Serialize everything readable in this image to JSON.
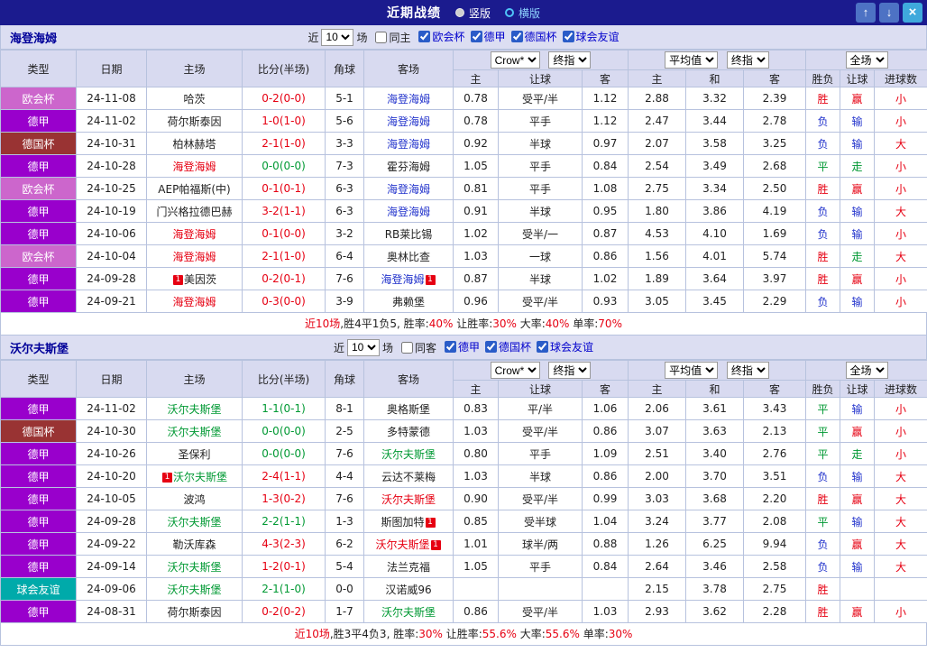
{
  "title_bar": {
    "title": "近期战绩",
    "vertical_label": "竖版",
    "horizontal_label": "横版",
    "up_icon": "↑",
    "down_icon": "↓",
    "close_icon": "×"
  },
  "colors": {
    "red": "#e60012",
    "green": "#009933",
    "blue": "#2233cc",
    "black": "#222222"
  },
  "league_colors": {
    "欧会杯": "#cc66cc",
    "德甲": "#9900cc",
    "德国杯": "#993333",
    "球会友谊": "#00aaaa"
  },
  "table_header": {
    "base_cols": [
      "类型",
      "日期",
      "主场",
      "比分(半场)",
      "角球",
      "客场"
    ],
    "sub_cols": [
      "主",
      "让球",
      "客",
      "主",
      "和",
      "客",
      "胜负",
      "让球",
      "进球数"
    ],
    "selects": {
      "book": "Crow*",
      "book_time": "终指",
      "avg": "平均值",
      "avg_time": "终指",
      "full": "全场"
    }
  },
  "sections": [
    {
      "team": "海登海姆",
      "filter": {
        "near": "近",
        "count": "10",
        "games": "场",
        "same": "同主",
        "leagues": [
          "欧会杯",
          "德甲",
          "德国杯",
          "球会友谊"
        ]
      },
      "rows": [
        {
          "type": "欧会杯",
          "date": "24-11-08",
          "home": "哈茨",
          "home_color": "black",
          "home_badge": "",
          "score": "0-2(0-0)",
          "score_color": "red",
          "corners": "5-1",
          "away": "海登海姆",
          "away_color": "blue",
          "away_badge": "",
          "h_home": "0.78",
          "h_line": "受平/半",
          "h_away": "1.12",
          "e_home": "2.88",
          "e_draw": "3.32",
          "e_away": "2.39",
          "result": "胜",
          "result_color": "red",
          "h_result": "赢",
          "h_result_color": "red",
          "g_result": "小",
          "g_result_color": "red"
        },
        {
          "type": "德甲",
          "date": "24-11-02",
          "home": "荷尔斯泰因",
          "home_color": "black",
          "home_badge": "",
          "score": "1-0(1-0)",
          "score_color": "red",
          "corners": "5-6",
          "away": "海登海姆",
          "away_color": "blue",
          "away_badge": "",
          "h_home": "0.78",
          "h_line": "平手",
          "h_away": "1.12",
          "e_home": "2.47",
          "e_draw": "3.44",
          "e_away": "2.78",
          "result": "负",
          "result_color": "blue",
          "h_result": "输",
          "h_result_color": "blue",
          "g_result": "小",
          "g_result_color": "red"
        },
        {
          "type": "德国杯",
          "date": "24-10-31",
          "home": "柏林赫塔",
          "home_color": "black",
          "home_badge": "",
          "score": "2-1(1-0)",
          "score_color": "red",
          "corners": "3-3",
          "away": "海登海姆",
          "away_color": "blue",
          "away_badge": "",
          "h_home": "0.92",
          "h_line": "半球",
          "h_away": "0.97",
          "e_home": "2.07",
          "e_draw": "3.58",
          "e_away": "3.25",
          "result": "负",
          "result_color": "blue",
          "h_result": "输",
          "h_result_color": "blue",
          "g_result": "大",
          "g_result_color": "red"
        },
        {
          "type": "德甲",
          "date": "24-10-28",
          "home": "海登海姆",
          "home_color": "red",
          "home_badge": "",
          "score": "0-0(0-0)",
          "score_color": "green",
          "corners": "7-3",
          "away": "霍芬海姆",
          "away_color": "black",
          "away_badge": "",
          "h_home": "1.05",
          "h_line": "平手",
          "h_away": "0.84",
          "e_home": "2.54",
          "e_draw": "3.49",
          "e_away": "2.68",
          "result": "平",
          "result_color": "green",
          "h_result": "走",
          "h_result_color": "green",
          "g_result": "小",
          "g_result_color": "red"
        },
        {
          "type": "欧会杯",
          "date": "24-10-25",
          "home": "AEP帕福斯(中)",
          "home_color": "black",
          "home_badge": "",
          "score": "0-1(0-1)",
          "score_color": "red",
          "corners": "6-3",
          "away": "海登海姆",
          "away_color": "blue",
          "away_badge": "",
          "h_home": "0.81",
          "h_line": "平手",
          "h_away": "1.08",
          "e_home": "2.75",
          "e_draw": "3.34",
          "e_away": "2.50",
          "result": "胜",
          "result_color": "red",
          "h_result": "赢",
          "h_result_color": "red",
          "g_result": "小",
          "g_result_color": "red"
        },
        {
          "type": "德甲",
          "date": "24-10-19",
          "home": "门兴格拉德巴赫",
          "home_color": "black",
          "home_badge": "",
          "score": "3-2(1-1)",
          "score_color": "red",
          "corners": "6-3",
          "away": "海登海姆",
          "away_color": "blue",
          "away_badge": "",
          "h_home": "0.91",
          "h_line": "半球",
          "h_away": "0.95",
          "e_home": "1.80",
          "e_draw": "3.86",
          "e_away": "4.19",
          "result": "负",
          "result_color": "blue",
          "h_result": "输",
          "h_result_color": "blue",
          "g_result": "大",
          "g_result_color": "red"
        },
        {
          "type": "德甲",
          "date": "24-10-06",
          "home": "海登海姆",
          "home_color": "red",
          "home_badge": "",
          "score": "0-1(0-0)",
          "score_color": "red",
          "corners": "3-2",
          "away": "RB莱比锡",
          "away_color": "black",
          "away_badge": "",
          "h_home": "1.02",
          "h_line": "受半/一",
          "h_away": "0.87",
          "e_home": "4.53",
          "e_draw": "4.10",
          "e_away": "1.69",
          "result": "负",
          "result_color": "blue",
          "h_result": "输",
          "h_result_color": "blue",
          "g_result": "小",
          "g_result_color": "red"
        },
        {
          "type": "欧会杯",
          "date": "24-10-04",
          "home": "海登海姆",
          "home_color": "red",
          "home_badge": "",
          "score": "2-1(1-0)",
          "score_color": "red",
          "corners": "6-4",
          "away": "奥林比查",
          "away_color": "black",
          "away_badge": "",
          "h_home": "1.03",
          "h_line": "一球",
          "h_away": "0.86",
          "e_home": "1.56",
          "e_draw": "4.01",
          "e_away": "5.74",
          "result": "胜",
          "result_color": "red",
          "h_result": "走",
          "h_result_color": "green",
          "g_result": "大",
          "g_result_color": "red"
        },
        {
          "type": "德甲",
          "date": "24-09-28",
          "home": "美因茨",
          "home_color": "black",
          "home_badge": "1",
          "score": "0-2(0-1)",
          "score_color": "red",
          "corners": "7-6",
          "away": "海登海姆",
          "away_color": "blue",
          "away_badge": "1",
          "h_home": "0.87",
          "h_line": "半球",
          "h_away": "1.02",
          "e_home": "1.89",
          "e_draw": "3.64",
          "e_away": "3.97",
          "result": "胜",
          "result_color": "red",
          "h_result": "赢",
          "h_result_color": "red",
          "g_result": "小",
          "g_result_color": "red"
        },
        {
          "type": "德甲",
          "date": "24-09-21",
          "home": "海登海姆",
          "home_color": "red",
          "home_badge": "",
          "score": "0-3(0-0)",
          "score_color": "red",
          "corners": "3-9",
          "away": "弗赖堡",
          "away_color": "black",
          "away_badge": "",
          "h_home": "0.96",
          "h_line": "受平/半",
          "h_away": "0.93",
          "e_home": "3.05",
          "e_draw": "3.45",
          "e_away": "2.29",
          "result": "负",
          "result_color": "blue",
          "h_result": "输",
          "h_result_color": "blue",
          "g_result": "小",
          "g_result_color": "red"
        }
      ],
      "summary": [
        {
          "t": "近10场",
          "c": "red"
        },
        {
          "t": ",胜4平1负5, 胜率:",
          "c": "black"
        },
        {
          "t": "40%",
          "c": "red"
        },
        {
          "t": " 让胜率:",
          "c": "black"
        },
        {
          "t": "30%",
          "c": "red"
        },
        {
          "t": " 大率:",
          "c": "black"
        },
        {
          "t": "40%",
          "c": "red"
        },
        {
          "t": " 单率:",
          "c": "black"
        },
        {
          "t": "70%",
          "c": "red"
        }
      ]
    },
    {
      "team": "沃尔夫斯堡",
      "filter": {
        "near": "近",
        "count": "10",
        "games": "场",
        "same": "同客",
        "leagues": [
          "德甲",
          "德国杯",
          "球会友谊"
        ]
      },
      "rows": [
        {
          "type": "德甲",
          "date": "24-11-02",
          "home": "沃尔夫斯堡",
          "home_color": "green",
          "home_badge": "",
          "score": "1-1(0-1)",
          "score_color": "green",
          "corners": "8-1",
          "away": "奥格斯堡",
          "away_color": "black",
          "away_badge": "",
          "h_home": "0.83",
          "h_line": "平/半",
          "h_away": "1.06",
          "e_home": "2.06",
          "e_draw": "3.61",
          "e_away": "3.43",
          "result": "平",
          "result_color": "green",
          "h_result": "输",
          "h_result_color": "blue",
          "g_result": "小",
          "g_result_color": "red"
        },
        {
          "type": "德国杯",
          "date": "24-10-30",
          "home": "沃尔夫斯堡",
          "home_color": "green",
          "home_badge": "",
          "score": "0-0(0-0)",
          "score_color": "green",
          "corners": "2-5",
          "away": "多特蒙德",
          "away_color": "black",
          "away_badge": "",
          "h_home": "1.03",
          "h_line": "受平/半",
          "h_away": "0.86",
          "e_home": "3.07",
          "e_draw": "3.63",
          "e_away": "2.13",
          "result": "平",
          "result_color": "green",
          "h_result": "赢",
          "h_result_color": "red",
          "g_result": "小",
          "g_result_color": "red"
        },
        {
          "type": "德甲",
          "date": "24-10-26",
          "home": "圣保利",
          "home_color": "black",
          "home_badge": "",
          "score": "0-0(0-0)",
          "score_color": "green",
          "corners": "7-6",
          "away": "沃尔夫斯堡",
          "away_color": "green",
          "away_badge": "",
          "h_home": "0.80",
          "h_line": "平手",
          "h_away": "1.09",
          "e_home": "2.51",
          "e_draw": "3.40",
          "e_away": "2.76",
          "result": "平",
          "result_color": "green",
          "h_result": "走",
          "h_result_color": "green",
          "g_result": "小",
          "g_result_color": "red"
        },
        {
          "type": "德甲",
          "date": "24-10-20",
          "home": "沃尔夫斯堡",
          "home_color": "green",
          "home_badge": "1",
          "score": "2-4(1-1)",
          "score_color": "red",
          "corners": "4-4",
          "away": "云达不莱梅",
          "away_color": "black",
          "away_badge": "",
          "h_home": "1.03",
          "h_line": "半球",
          "h_away": "0.86",
          "e_home": "2.00",
          "e_draw": "3.70",
          "e_away": "3.51",
          "result": "负",
          "result_color": "blue",
          "h_result": "输",
          "h_result_color": "blue",
          "g_result": "大",
          "g_result_color": "red"
        },
        {
          "type": "德甲",
          "date": "24-10-05",
          "home": "波鸿",
          "home_color": "black",
          "home_badge": "",
          "score": "1-3(0-2)",
          "score_color": "red",
          "corners": "7-6",
          "away": "沃尔夫斯堡",
          "away_color": "red",
          "away_badge": "",
          "h_home": "0.90",
          "h_line": "受平/半",
          "h_away": "0.99",
          "e_home": "3.03",
          "e_draw": "3.68",
          "e_away": "2.20",
          "result": "胜",
          "result_color": "red",
          "h_result": "赢",
          "h_result_color": "red",
          "g_result": "大",
          "g_result_color": "red"
        },
        {
          "type": "德甲",
          "date": "24-09-28",
          "home": "沃尔夫斯堡",
          "home_color": "green",
          "home_badge": "",
          "score": "2-2(1-1)",
          "score_color": "green",
          "corners": "1-3",
          "away": "斯图加特",
          "away_color": "black",
          "away_badge": "1",
          "h_home": "0.85",
          "h_line": "受半球",
          "h_away": "1.04",
          "e_home": "3.24",
          "e_draw": "3.77",
          "e_away": "2.08",
          "result": "平",
          "result_color": "green",
          "h_result": "输",
          "h_result_color": "blue",
          "g_result": "大",
          "g_result_color": "red"
        },
        {
          "type": "德甲",
          "date": "24-09-22",
          "home": "勒沃库森",
          "home_color": "black",
          "home_badge": "",
          "score": "4-3(2-3)",
          "score_color": "red",
          "corners": "6-2",
          "away": "沃尔夫斯堡",
          "away_color": "red",
          "away_badge": "1",
          "h_home": "1.01",
          "h_line": "球半/两",
          "h_away": "0.88",
          "e_home": "1.26",
          "e_draw": "6.25",
          "e_away": "9.94",
          "result": "负",
          "result_color": "blue",
          "h_result": "赢",
          "h_result_color": "red",
          "g_result": "大",
          "g_result_color": "red"
        },
        {
          "type": "德甲",
          "date": "24-09-14",
          "home": "沃尔夫斯堡",
          "home_color": "green",
          "home_badge": "",
          "score": "1-2(0-1)",
          "score_color": "red",
          "corners": "5-4",
          "away": "法兰克福",
          "away_color": "black",
          "away_badge": "",
          "h_home": "1.05",
          "h_line": "平手",
          "h_away": "0.84",
          "e_home": "2.64",
          "e_draw": "3.46",
          "e_away": "2.58",
          "result": "负",
          "result_color": "blue",
          "h_result": "输",
          "h_result_color": "blue",
          "g_result": "大",
          "g_result_color": "red"
        },
        {
          "type": "球会友谊",
          "date": "24-09-06",
          "home": "沃尔夫斯堡",
          "home_color": "green",
          "home_badge": "",
          "score": "2-1(1-0)",
          "score_color": "green",
          "corners": "0-0",
          "away": "汉诺威96",
          "away_color": "black",
          "away_badge": "",
          "h_home": "",
          "h_line": "",
          "h_away": "",
          "e_home": "2.15",
          "e_draw": "3.78",
          "e_away": "2.75",
          "result": "胜",
          "result_color": "red",
          "h_result": "",
          "h_result_color": "black",
          "g_result": "",
          "g_result_color": "black"
        },
        {
          "type": "德甲",
          "date": "24-08-31",
          "home": "荷尔斯泰因",
          "home_color": "black",
          "home_badge": "",
          "score": "0-2(0-2)",
          "score_color": "red",
          "corners": "1-7",
          "away": "沃尔夫斯堡",
          "away_color": "green",
          "away_badge": "",
          "h_home": "0.86",
          "h_line": "受平/半",
          "h_away": "1.03",
          "e_home": "2.93",
          "e_draw": "3.62",
          "e_away": "2.28",
          "result": "胜",
          "result_color": "red",
          "h_result": "赢",
          "h_result_color": "red",
          "g_result": "小",
          "g_result_color": "red"
        }
      ],
      "summary": [
        {
          "t": "近10场",
          "c": "red"
        },
        {
          "t": ",胜3平4负3, 胜率:",
          "c": "black"
        },
        {
          "t": "30%",
          "c": "red"
        },
        {
          "t": " 让胜率:",
          "c": "black"
        },
        {
          "t": "55.6%",
          "c": "red"
        },
        {
          "t": " 大率:",
          "c": "black"
        },
        {
          "t": "55.6%",
          "c": "red"
        },
        {
          "t": " 单率:",
          "c": "black"
        },
        {
          "t": "30%",
          "c": "red"
        }
      ]
    }
  ]
}
